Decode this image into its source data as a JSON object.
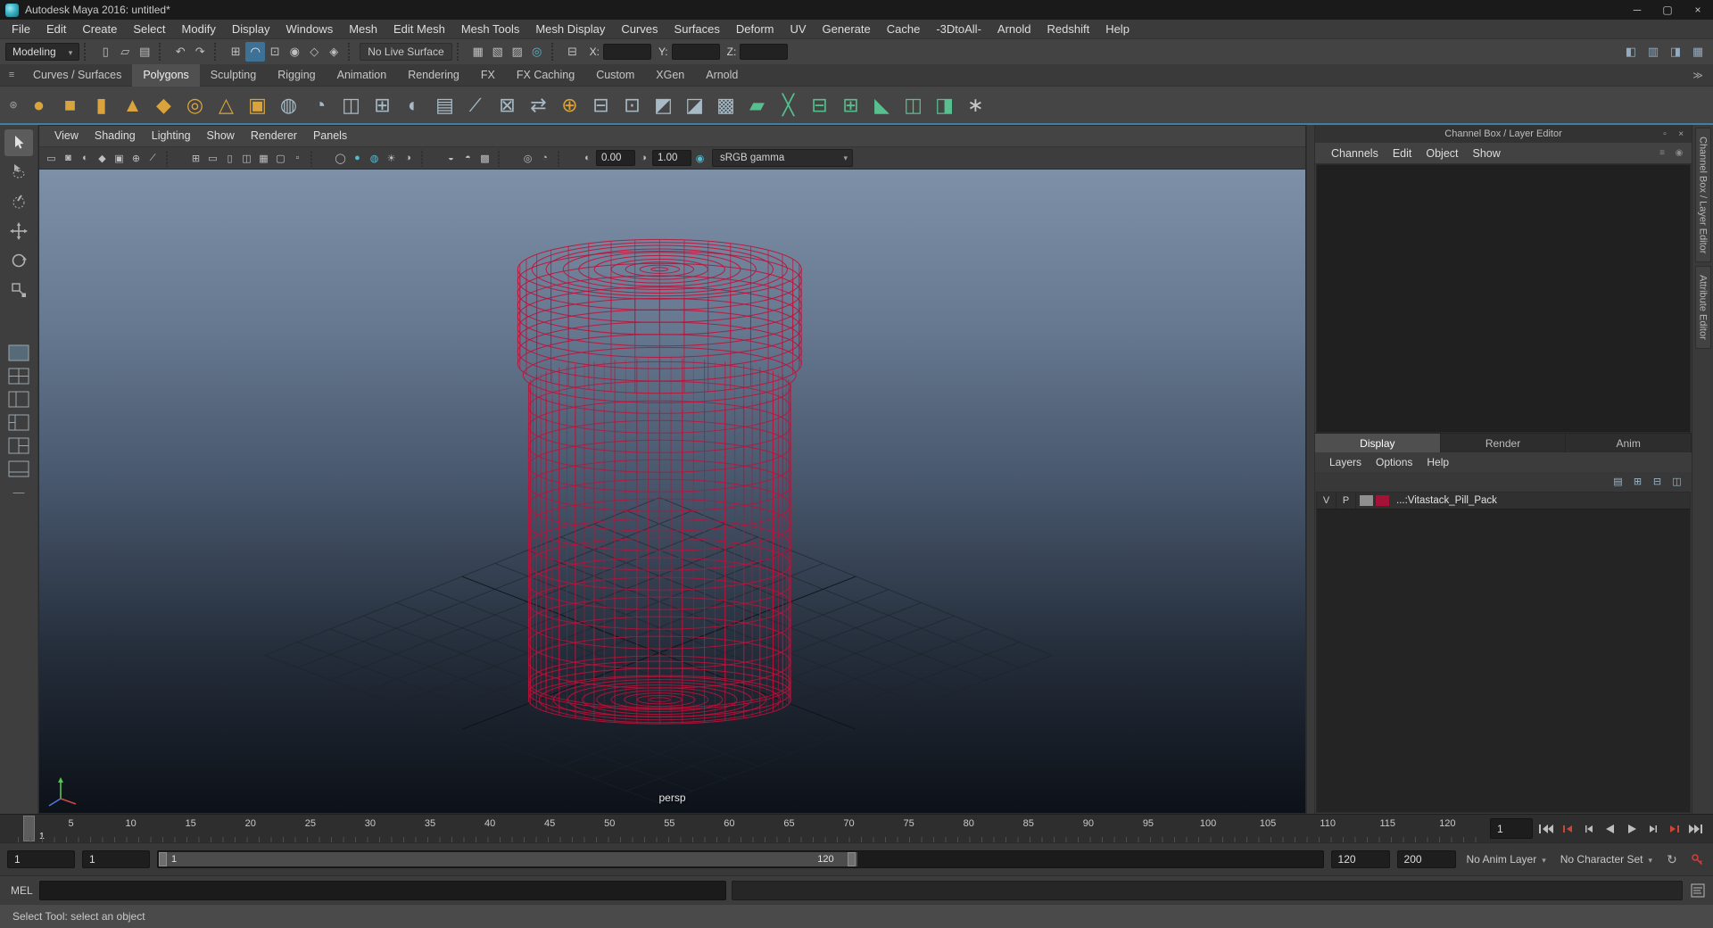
{
  "window": {
    "title": "Autodesk Maya 2016: untitled*",
    "controls": [
      {
        "name": "minimize-button",
        "g": "─"
      },
      {
        "name": "maximize-button",
        "g": "▢"
      },
      {
        "name": "close-button",
        "g": "×"
      }
    ]
  },
  "menu_bar": {
    "items": [
      "File",
      "Edit",
      "Create",
      "Select",
      "Modify",
      "Display",
      "Windows",
      "Mesh",
      "Edit Mesh",
      "Mesh Tools",
      "Mesh Display",
      "Curves",
      "Surfaces",
      "Deform",
      "UV",
      "Generate",
      "Cache",
      "-3DtoAll-",
      "Arnold",
      "Redshift",
      "Help"
    ]
  },
  "status_line": {
    "menuset": "Modeling",
    "file_icons": [
      {
        "name": "new-scene-icon",
        "g": "▯"
      },
      {
        "name": "open-scene-icon",
        "g": "▱"
      },
      {
        "name": "save-scene-icon",
        "g": "▤"
      }
    ],
    "edit_icons": [
      {
        "name": "undo-icon",
        "g": "↶"
      },
      {
        "name": "redo-icon",
        "g": "↷"
      }
    ],
    "snap_icons": [
      {
        "name": "snap-to-grids-icon",
        "g": "⊞"
      },
      {
        "name": "snap-to-curves-icon",
        "g": "◠",
        "active": true
      },
      {
        "name": "snap-to-points-icon",
        "g": "⊡"
      },
      {
        "name": "snap-to-projected-center-icon",
        "g": "◉"
      },
      {
        "name": "snap-to-view-planes-icon",
        "g": "◇"
      },
      {
        "name": "make-live-icon",
        "g": "◈"
      }
    ],
    "no_live_surface": "No Live Surface",
    "render_icons": [
      {
        "name": "render-view-icon",
        "g": "▦"
      },
      {
        "name": "render-current-frame-icon",
        "g": "▧"
      },
      {
        "name": "ipr-render-icon",
        "g": "▨"
      },
      {
        "name": "render-settings-icon",
        "g": "◎",
        "cls": "teal"
      }
    ],
    "symmetry_icons": [
      {
        "name": "symmetry-settings-icon",
        "g": "⊟"
      }
    ],
    "axis": {
      "x_label": "X:",
      "y_label": "Y:",
      "z_label": "Z:",
      "x_value": "",
      "y_value": "",
      "z_value": ""
    },
    "right_icons": [
      {
        "name": "modeling-toolkit-icon",
        "g": "◧"
      },
      {
        "name": "hypershade-icon",
        "g": "▥"
      },
      {
        "name": "tool-settings-icon",
        "g": "◨"
      },
      {
        "name": "channel-box-toggle-icon",
        "g": "▦"
      }
    ]
  },
  "shelf": {
    "menu_icon": "≡",
    "gear_icon": "⊛",
    "overflow_icon": "≫",
    "tabs": [
      {
        "label": "Curves / Surfaces"
      },
      {
        "label": "Polygons",
        "active": true
      },
      {
        "label": "Sculpting"
      },
      {
        "label": "Rigging"
      },
      {
        "label": "Animation"
      },
      {
        "label": "Rendering"
      },
      {
        "label": "FX"
      },
      {
        "label": "FX Caching"
      },
      {
        "label": "Custom"
      },
      {
        "label": "XGen"
      },
      {
        "label": "Arnold"
      }
    ],
    "items": [
      {
        "name": "poly-sphere-icon",
        "g": "●",
        "color": "#d9a43e"
      },
      {
        "name": "poly-cube-icon",
        "g": "■",
        "color": "#d9a43e"
      },
      {
        "name": "poly-cylinder-icon",
        "g": "▮",
        "color": "#d9a43e"
      },
      {
        "name": "poly-cone-icon",
        "g": "▲",
        "color": "#d9a43e"
      },
      {
        "name": "poly-platonic-icon",
        "g": "◆",
        "color": "#d9a43e"
      },
      {
        "name": "poly-torus-icon",
        "g": "◎",
        "color": "#d9a43e"
      },
      {
        "name": "poly-pyramid-icon",
        "g": "△",
        "color": "#d9a43e"
      },
      {
        "name": "poly-pipe-icon",
        "g": "▣",
        "color": "#d9a43e"
      },
      {
        "name": "smooth-mesh-icon",
        "g": "◍",
        "color": "#a7bac6"
      },
      {
        "name": "reduce-mesh-icon",
        "g": "◔",
        "color": "#a7bac6"
      },
      {
        "name": "boolean-icon",
        "g": "◫",
        "color": "#a7bac6"
      },
      {
        "name": "quadrangulate-icon",
        "g": "⊞",
        "color": "#a7bac6"
      },
      {
        "name": "sculpt-tool-icon",
        "g": "◐",
        "color": "#a7bac6"
      },
      {
        "name": "flatten-icon",
        "g": "▤",
        "color": "#a7bac6"
      },
      {
        "name": "pencil-curve-icon",
        "g": "∕",
        "color": "#a7bac6"
      },
      {
        "name": "extrude-icon",
        "g": "⊠",
        "color": "#a7bac6"
      },
      {
        "name": "slide-edge-icon",
        "g": "⇄",
        "color": "#a7bac6"
      },
      {
        "name": "combine-icon",
        "g": "⊕",
        "color": "#d9a43e"
      },
      {
        "name": "fill-hole-icon",
        "g": "⊟",
        "color": "#a7bac6"
      },
      {
        "name": "make-hole-icon",
        "g": "⊡",
        "color": "#a7bac6"
      },
      {
        "name": "project-curve-icon",
        "g": "◩",
        "color": "#a7bac6"
      },
      {
        "name": "split-mesh-icon",
        "g": "◪",
        "color": "#a7bac6"
      },
      {
        "name": "assign-material-icon",
        "g": "▩",
        "color": "#a7bac6"
      },
      {
        "name": "quad-draw-icon",
        "g": "▰",
        "color": "#58bf8f"
      },
      {
        "name": "multi-cut-icon",
        "g": "╳",
        "color": "#58bf8f"
      },
      {
        "name": "insert-edge-loop-icon",
        "g": "⊟",
        "color": "#58bf8f"
      },
      {
        "name": "offset-edge-loop-icon",
        "g": "⊞",
        "color": "#58bf8f"
      },
      {
        "name": "crease-tool-icon",
        "g": "◣",
        "color": "#58bf8f"
      },
      {
        "name": "make-symmetric-icon",
        "g": "◫",
        "color": "#58bf8f"
      },
      {
        "name": "mirror-geometry-icon",
        "g": "◨",
        "color": "#58bf8f"
      },
      {
        "name": "paint-transfer-icon",
        "g": "∗",
        "color": "#c8c8c8"
      }
    ]
  },
  "toolbox": {
    "tools": [
      "select-tool",
      "lasso-select-tool",
      "paint-select-tool",
      "move-tool",
      "rotate-tool",
      "scale-tool"
    ],
    "layouts": [
      "layout-single-pane",
      "layout-four-pane",
      "layout-split-vertical",
      "layout-persp-outliner",
      "layout-three-pane",
      "layout-custom"
    ]
  },
  "viewport": {
    "menus": [
      "View",
      "Shading",
      "Lighting",
      "Show",
      "Renderer",
      "Panels"
    ],
    "toolbar": {
      "icons": [
        {
          "name": "select-camera-icon",
          "g": "▭"
        },
        {
          "name": "lock-camera-icon",
          "g": "◙"
        },
        {
          "name": "camera-attributes-icon",
          "g": "◐"
        },
        {
          "name": "bookmarks-icon",
          "g": "◆"
        },
        {
          "name": "image-plane-icon",
          "g": "▣"
        },
        {
          "name": "pan-zoom-icon",
          "g": "⊕"
        },
        {
          "name": "grease-pencil-icon",
          "g": "∕"
        },
        {
          "cls": "sep"
        },
        {
          "name": "grid-toggle-icon",
          "g": "⊞"
        },
        {
          "name": "film-gate-icon",
          "g": "▭"
        },
        {
          "name": "resolution-gate-icon",
          "g": "▯"
        },
        {
          "name": "gate-mask-icon",
          "g": "◫"
        },
        {
          "name": "field-chart-icon",
          "g": "▦"
        },
        {
          "name": "safe-action-icon",
          "g": "▢"
        },
        {
          "name": "safe-title-icon",
          "g": "▫"
        },
        {
          "cls": "sep"
        },
        {
          "name": "wireframe-mode-icon",
          "g": "◯"
        },
        {
          "name": "shaded-mode-icon",
          "g": "●",
          "cls": "teal"
        },
        {
          "name": "textured-mode-icon",
          "g": "◍",
          "cls": "teal"
        },
        {
          "name": "lights-mode-icon",
          "g": "☀"
        },
        {
          "name": "shadows-mode-icon",
          "g": "◑"
        },
        {
          "cls": "sep"
        },
        {
          "name": "ao-toggle-icon",
          "g": "◒"
        },
        {
          "name": "motion-blur-icon",
          "g": "◓"
        },
        {
          "name": "multisample-icon",
          "g": "▩"
        },
        {
          "cls": "sep"
        },
        {
          "name": "isolate-select-icon",
          "g": "◎"
        },
        {
          "name": "xray-mode-icon",
          "g": "◔"
        },
        {
          "cls": "sep"
        },
        {
          "name": "exposure-icon",
          "g": "◐"
        }
      ],
      "exposure": "0.00",
      "gamma_icon_glyph": "◑",
      "gamma": "1.00",
      "cm_icon_glyph": "◉",
      "view_transform": "sRGB gamma"
    },
    "camera_label": "persp"
  },
  "channel_box": {
    "title": "Channel Box / Layer Editor",
    "header_icons": [
      {
        "name": "dock-icon",
        "g": "▫"
      },
      {
        "name": "close-icon",
        "g": "×"
      }
    ],
    "menus": [
      "Channels",
      "Edit",
      "Object",
      "Show"
    ],
    "menu_icons": [
      {
        "name": "channel-slider-mode-icon",
        "g": "≡"
      },
      {
        "name": "channel-stats-icon",
        "g": "◉"
      }
    ]
  },
  "layer_editor": {
    "tabs": [
      {
        "label": "Display",
        "active": true
      },
      {
        "label": "Render"
      },
      {
        "label": "Anim"
      }
    ],
    "menus": [
      "Layers",
      "Options",
      "Help"
    ],
    "toolbar_icons": [
      {
        "name": "edit-layer-icon",
        "g": "▤"
      },
      {
        "name": "new-empty-layer-icon",
        "g": "⊞"
      },
      {
        "name": "new-layer-from-selected-icon",
        "g": "⊟"
      },
      {
        "name": "layer-options-icon",
        "g": "◫"
      }
    ],
    "layer": {
      "visible": "V",
      "playback": "P",
      "color": "#a51238",
      "name": "...:Vitastack_Pill_Pack"
    }
  },
  "side_tabs": [
    {
      "label": "Channel Box / Layer Editor"
    },
    {
      "label": "Attribute Editor"
    }
  ],
  "time_slider": {
    "ticks": [
      5,
      10,
      15,
      20,
      25,
      30,
      35,
      40,
      45,
      50,
      55,
      60,
      65,
      70,
      75,
      80,
      85,
      90,
      95,
      100,
      105,
      110,
      115,
      120
    ],
    "playhead_label": "1",
    "current_frame": "1",
    "transport": [
      "go-to-start",
      "step-back-key",
      "step-back-frame",
      "play-backward",
      "play-forward",
      "step-forward-frame",
      "step-forward-key",
      "go-to-end"
    ]
  },
  "range_slider": {
    "playback_start": "1",
    "anim_start": "1",
    "range_start": "1",
    "range_end": "120",
    "playback_end": "120",
    "anim_end": "200",
    "anim_layer": "No Anim Layer",
    "character_set": "No Character Set",
    "prefs_icon": "↻"
  },
  "command_line": {
    "label": "MEL"
  },
  "help_line": {
    "text": "Select Tool: select an object"
  },
  "colors": {
    "accent": "#3e7fa8",
    "wireframe": "#c11039",
    "layer_swatch": "#a51238"
  }
}
